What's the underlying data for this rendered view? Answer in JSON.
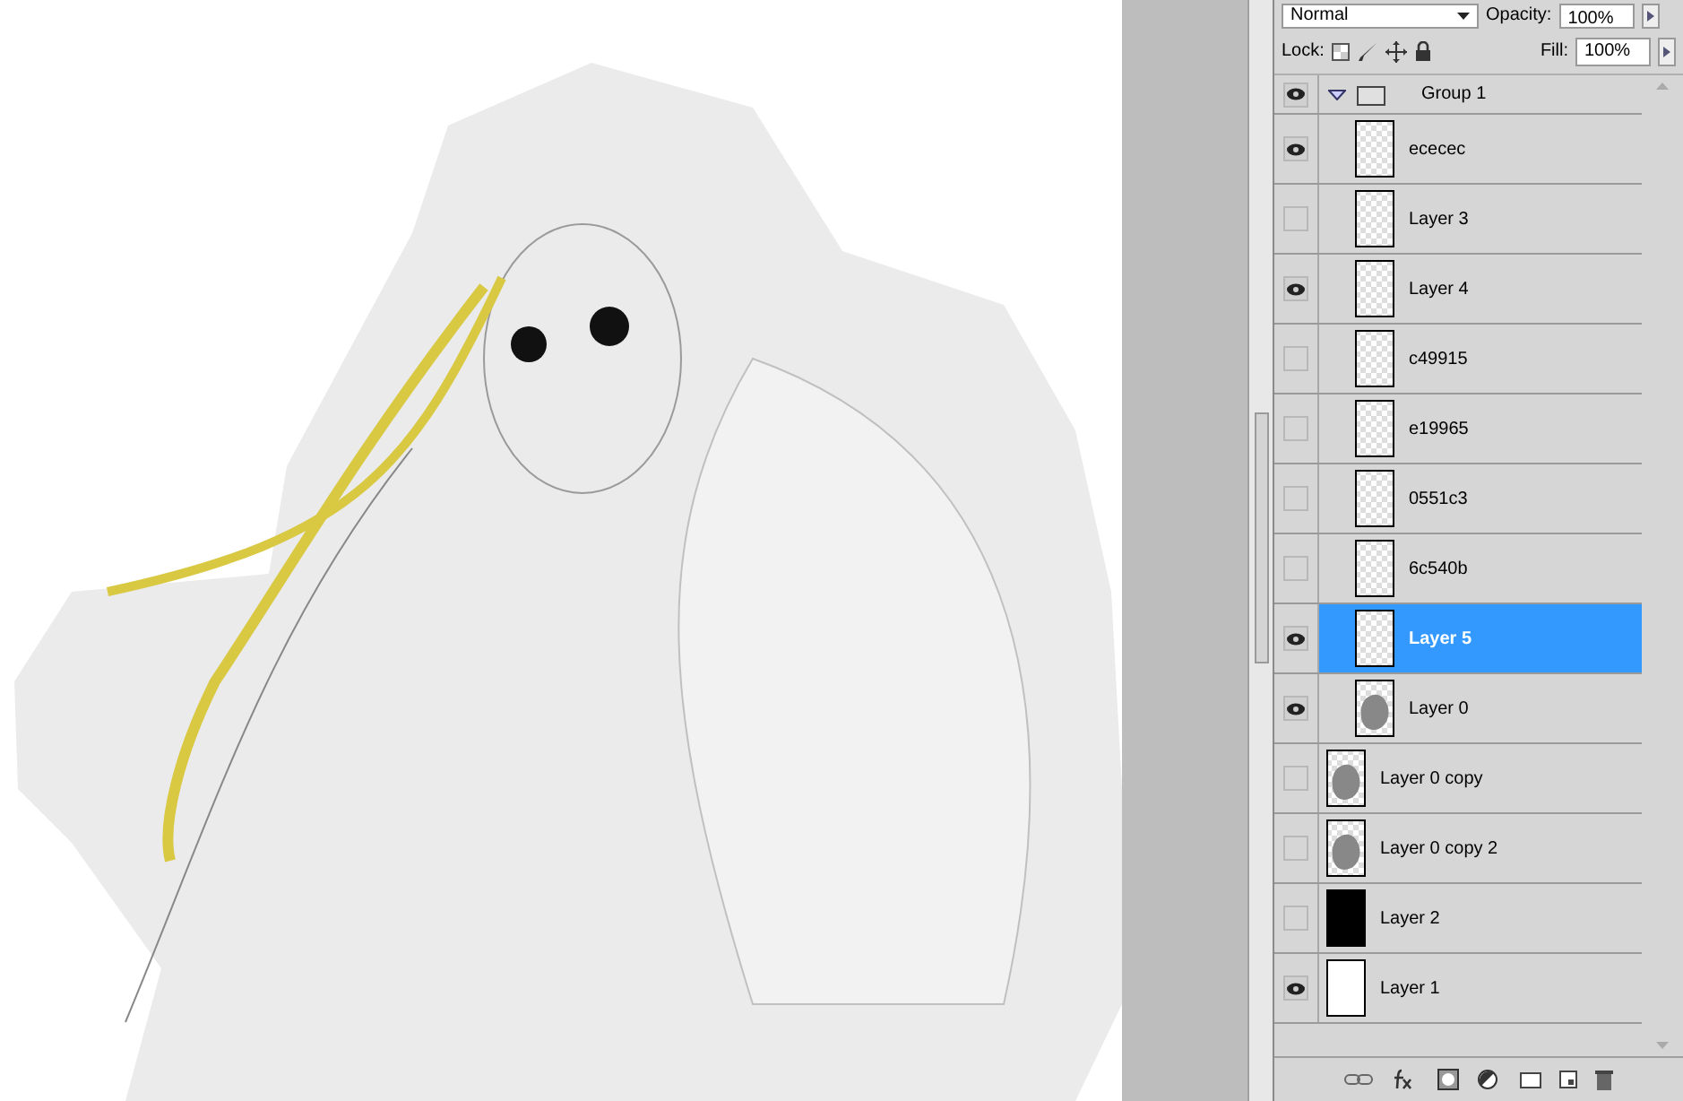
{
  "options": {
    "blend_mode": "Normal",
    "opacity_label": "Opacity:",
    "opacity": "100%",
    "lock_label": "Lock:",
    "fill_label": "Fill:",
    "fill": "100%"
  },
  "layers": [
    {
      "name": "Group 1",
      "kind": "group",
      "visible": true,
      "expanded": true,
      "selected": false,
      "children": [
        {
          "name": "ececec",
          "kind": "layer",
          "thumbnail": {
            "kind": "transparent"
          },
          "visible": true,
          "selected": false
        },
        {
          "name": "Layer 3",
          "kind": "layer",
          "thumbnail": {
            "kind": "transparent"
          },
          "visible": false,
          "selected": false
        },
        {
          "name": "Layer 4",
          "kind": "layer",
          "thumbnail": {
            "kind": "transparent"
          },
          "visible": true,
          "selected": false
        },
        {
          "name": "c49915",
          "kind": "layer",
          "thumbnail": {
            "kind": "transparent"
          },
          "visible": false,
          "selected": false
        },
        {
          "name": "e19965",
          "kind": "layer",
          "thumbnail": {
            "kind": "transparent"
          },
          "visible": false,
          "selected": false
        },
        {
          "name": "0551c3",
          "kind": "layer",
          "thumbnail": {
            "kind": "transparent"
          },
          "visible": false,
          "selected": false
        },
        {
          "name": "6c540b",
          "kind": "layer",
          "thumbnail": {
            "kind": "transparent"
          },
          "visible": false,
          "selected": false
        },
        {
          "name": "Layer 5",
          "kind": "layer",
          "thumbnail": {
            "kind": "transparent"
          },
          "visible": true,
          "selected": true
        },
        {
          "name": "Layer 0",
          "kind": "layer",
          "thumbnail": {
            "kind": "blob"
          },
          "visible": true,
          "selected": false
        }
      ]
    },
    {
      "name": "Layer 0 copy",
      "kind": "layer",
      "thumbnail": {
        "kind": "blob"
      },
      "visible": false,
      "selected": false
    },
    {
      "name": "Layer 0 copy 2",
      "kind": "layer",
      "thumbnail": {
        "kind": "blob"
      },
      "visible": false,
      "selected": false
    },
    {
      "name": "Layer 2",
      "kind": "layer",
      "thumbnail": {
        "kind": "black"
      },
      "visible": false,
      "selected": false
    },
    {
      "name": "Layer 1",
      "kind": "layer",
      "thumbnail": {
        "kind": "white"
      },
      "visible": true,
      "selected": false
    }
  ]
}
